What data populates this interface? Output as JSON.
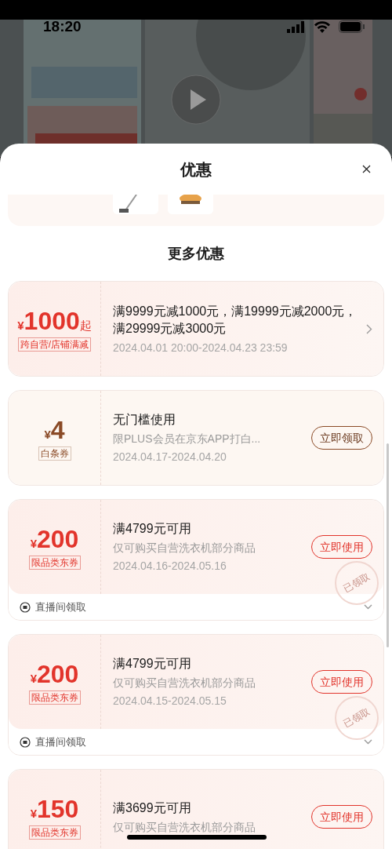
{
  "status_bar": {
    "time": "18:20"
  },
  "sheet": {
    "title": "优惠"
  },
  "section_title": "更多优惠",
  "coupons": [
    {
      "kind": "store",
      "currency": "¥",
      "amount": "1000",
      "suffix": "起",
      "tag": "跨自营/店铺满减",
      "title": "满9999元减1000元，满19999元减2000元，满29999元减3000元",
      "date": "2024.04.01 20:00-2024.04.23 23:59",
      "action": {
        "kind": "arrow"
      }
    },
    {
      "kind": "baitiao",
      "currency": "¥",
      "amount": "4",
      "tag": "白条券",
      "title": "无门槛使用",
      "desc": "限PLUS会员在京东APP打白...",
      "date": "2024.04.17-2024.04.20",
      "action": {
        "kind": "button",
        "label": "立即领取"
      }
    },
    {
      "kind": "category",
      "currency": "¥",
      "amount": "200",
      "tag": "限品类东券",
      "title": "满4799元可用",
      "desc": "仅可购买自营洗衣机部分商品",
      "date": "2024.04.16-2024.05.16",
      "action": {
        "kind": "button",
        "label": "立即使用"
      },
      "stamp": "已领取",
      "footer": {
        "label": "直播间领取",
        "expanded": false
      }
    },
    {
      "kind": "category",
      "currency": "¥",
      "amount": "200",
      "tag": "限品类东券",
      "title": "满4799元可用",
      "desc": "仅可购买自营洗衣机部分商品",
      "date": "2024.04.15-2024.05.15",
      "action": {
        "kind": "button",
        "label": "立即使用"
      },
      "stamp": "已领取",
      "footer": {
        "label": "直播间领取",
        "expanded": false
      }
    },
    {
      "kind": "category",
      "currency": "¥",
      "amount": "150",
      "tag": "限品类东券",
      "title": "满3699元可用",
      "desc": "仅可购买自营洗衣机部分商品",
      "action": {
        "kind": "button",
        "label": "立即使用"
      }
    }
  ]
}
